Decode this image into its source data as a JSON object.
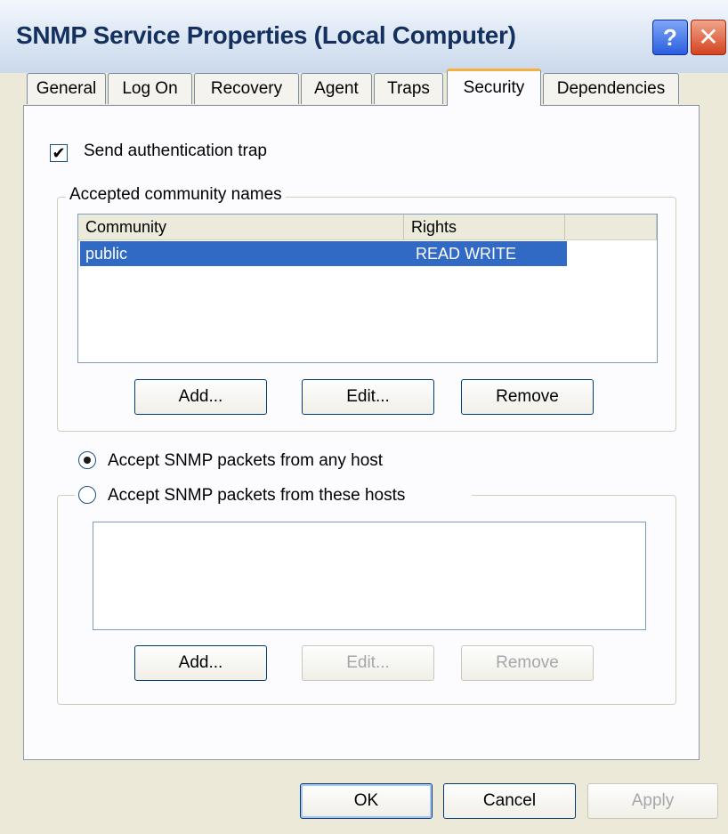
{
  "window": {
    "title": "SNMP Service Properties (Local Computer)",
    "help_glyph": "?",
    "close_glyph": "✕"
  },
  "tabs": [
    "General",
    "Log On",
    "Recovery",
    "Agent",
    "Traps",
    "Security",
    "Dependencies"
  ],
  "active_tab": "Security",
  "security": {
    "send_auth_trap_label": "Send authentication trap",
    "send_auth_trap_checked": true,
    "check_glyph": "✔",
    "communities_group_label": "Accepted community names",
    "columns": [
      "Community",
      "Rights"
    ],
    "rows": [
      {
        "community": "public",
        "rights": "READ WRITE",
        "selected": true
      }
    ],
    "community_buttons": {
      "add": "Add...",
      "edit": "Edit...",
      "remove": "Remove"
    },
    "accept_any_label": "Accept SNMP packets from any host",
    "accept_these_label": "Accept SNMP packets from these hosts",
    "selected_host_option": "any",
    "hosts": [],
    "host_buttons": {
      "add": "Add...",
      "edit": "Edit...",
      "remove": "Remove",
      "edit_enabled": false,
      "remove_enabled": false
    }
  },
  "footer": {
    "ok": "OK",
    "cancel": "Cancel",
    "apply": "Apply",
    "apply_enabled": false
  },
  "colors": {
    "title_text": "#14305e",
    "selection": "#316ac5",
    "active_tab_accent": "#f3b13d"
  }
}
